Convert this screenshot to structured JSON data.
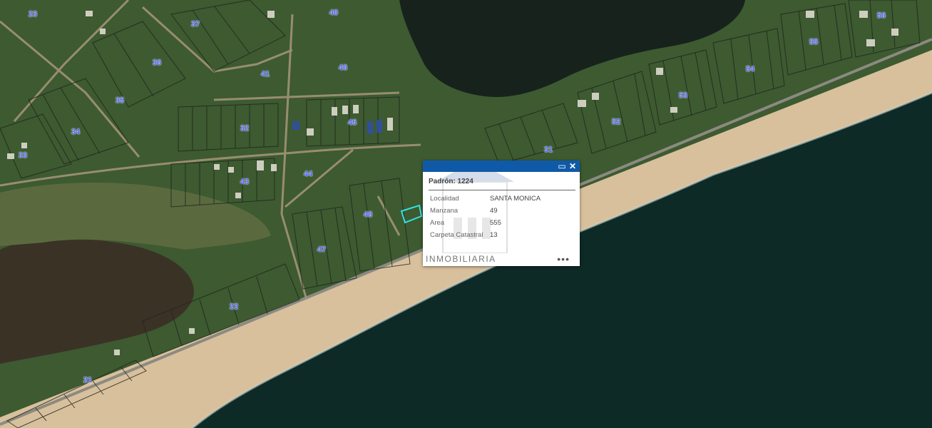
{
  "map": {
    "block_labels": [
      "23",
      "37",
      "40",
      "36",
      "41",
      "46",
      "35",
      "34",
      "33",
      "32",
      "45",
      "43",
      "44",
      "48",
      "47",
      "22",
      "21",
      "31",
      "52",
      "53",
      "54",
      "55",
      "56"
    ]
  },
  "colors": {
    "ocean": "#0d2a26",
    "lagoon": "#16201c",
    "sand": "#d9c2a0",
    "vegetation": "#3f5e34",
    "parcel_lines": "#222222",
    "selected_parcel": "#36e0e0",
    "popup_header": "#0f5aa8",
    "label_text": "#4e63ff"
  },
  "popup": {
    "title": "Padrón: 1224",
    "maximize_icon": "maximize-icon",
    "close_icon": "close-icon",
    "attributes": [
      {
        "key": "Localidad",
        "value": "SANTA MONICA"
      },
      {
        "key": "Manzana",
        "value": "49"
      },
      {
        "key": "Area",
        "value": "555"
      },
      {
        "key": "Carpeta Catastral",
        "value": "13"
      }
    ],
    "more_label": "•••",
    "watermark": "INMOBILIARIA"
  }
}
